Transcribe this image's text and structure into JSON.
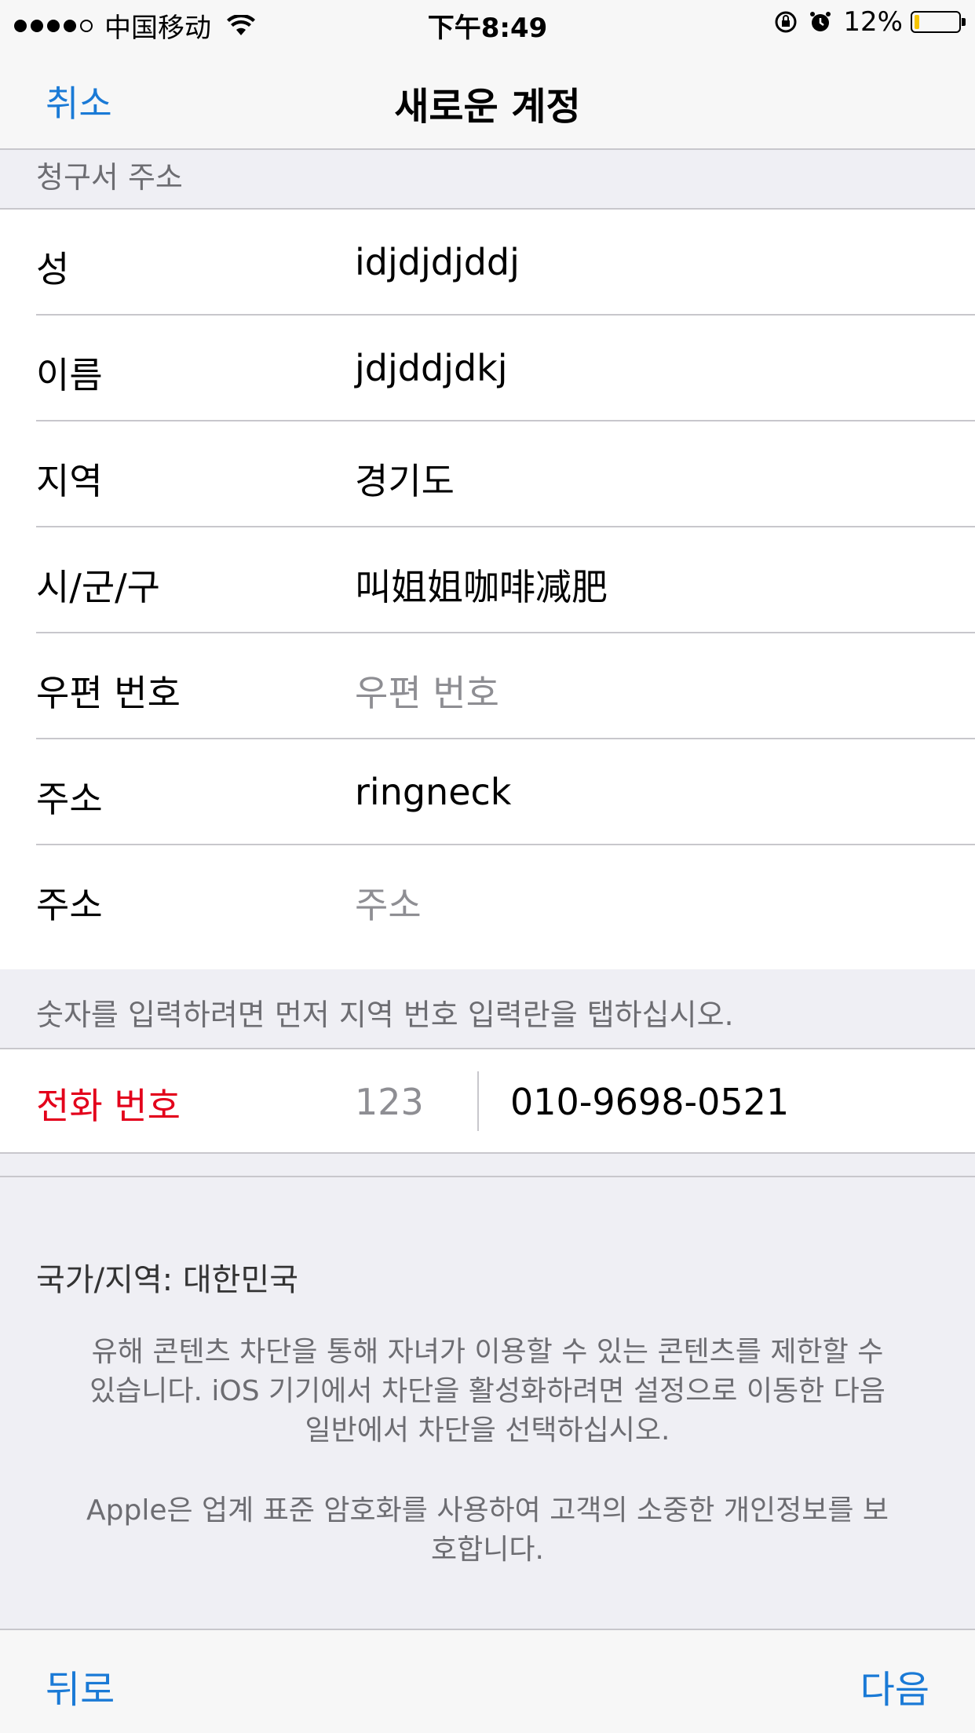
{
  "status_bar": {
    "carrier": "中国移动",
    "time": "下午8:49",
    "battery_percent": "12%",
    "battery_level": 0.12,
    "battery_color": "#f5c400"
  },
  "nav": {
    "cancel_label": "취소",
    "title": "새로운 계정"
  },
  "section_header": "청구서 주소",
  "form_rows": [
    {
      "label": "성",
      "value": "idjdjdjddj"
    },
    {
      "label": "이름",
      "value": "jdjddjdkj"
    },
    {
      "label": "지역",
      "value": "경기도"
    },
    {
      "label": "시/군/구",
      "value": "叫姐姐咖啡减肥"
    },
    {
      "label": "우편 번호",
      "placeholder": "우편 번호"
    },
    {
      "label": "주소",
      "value": "ringneck"
    },
    {
      "label": "주소",
      "placeholder": "주소"
    }
  ],
  "phone_hint": "숫자를 입력하려면 먼저 지역 번호 입력란을 탭하십시오.",
  "phone": {
    "label": "전화 번호",
    "label_color": "#e3001b",
    "area_code_placeholder": "123",
    "number": "010-9698-0521"
  },
  "footer": {
    "country": "국가/지역: 대한민국",
    "parental_line1": "유해 콘텐츠 차단을 통해 자녀가 이용할 수 있는 콘텐츠를 제한할 수",
    "parental_line2": "있습니다. iOS 기기에서 차단을 활성화하려면 설정으로 이동한 다음",
    "parental_line3": "일반에서 차단을 선택하십시오.",
    "privacy_line1": "Apple은 업계 표준 암호화를 사용하여 고객의 소중한 개인정보를 보",
    "privacy_line2": "호합니다."
  },
  "bottom": {
    "back_label": "뒤로",
    "next_label": "다음"
  },
  "colors": {
    "accent": "#1a7ad6",
    "background": "#efeff4"
  }
}
